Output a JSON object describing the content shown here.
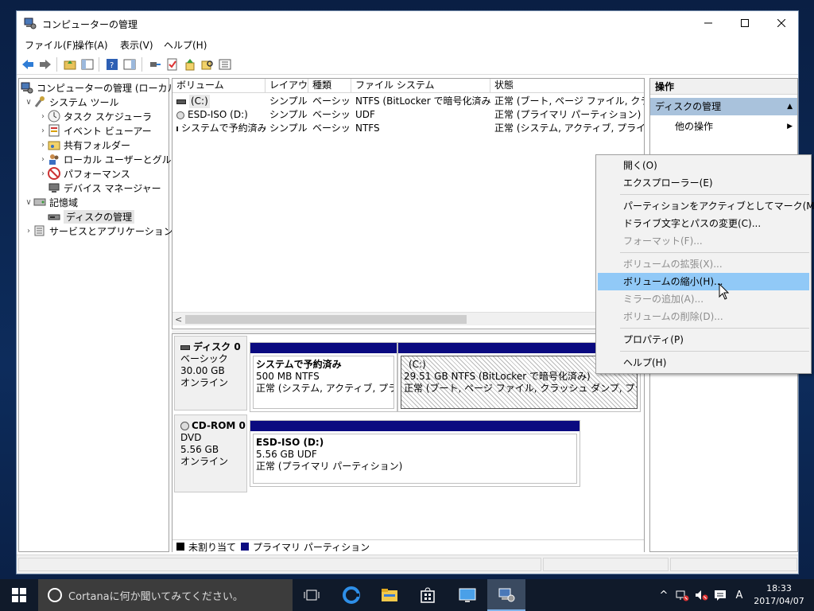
{
  "window": {
    "title": "コンピューターの管理"
  },
  "menu": [
    "ファイル(F)",
    "操作(A)",
    "表示(V)",
    "ヘルプ(H)"
  ],
  "tree": {
    "root": "コンピューターの管理 (ローカル)",
    "system_tools": "システム ツール",
    "task_scheduler": "タスク スケジューラ",
    "event_viewer": "イベント ビューアー",
    "shared_folders": "共有フォルダー",
    "local_users": "ローカル ユーザーとグループ",
    "performance": "パフォーマンス",
    "device_manager": "デバイス マネージャー",
    "storage": "記憶域",
    "disk_management": "ディスクの管理",
    "services": "サービスとアプリケーション"
  },
  "volume_list": {
    "columns": [
      "ボリューム",
      "レイアウト",
      "種類",
      "ファイル システム",
      "状態"
    ],
    "rows": [
      {
        "volume": "(C:)",
        "layout": "シンプル",
        "type": "ベーシック",
        "fs": "NTFS (BitLocker で暗号化済み)",
        "status": "正常 (ブート, ページ ファイル, クラッシュ ダ"
      },
      {
        "volume": "ESD-ISO (D:)",
        "layout": "シンプル",
        "type": "ベーシック",
        "fs": "UDF",
        "status": "正常 (プライマリ パーティション)"
      },
      {
        "volume": "システムで予約済み",
        "layout": "シンプル",
        "type": "ベーシック",
        "fs": "NTFS",
        "status": "正常 (システム, アクティブ, プライマリ パー"
      }
    ]
  },
  "disks": {
    "disk0": {
      "name": "ディスク 0",
      "type": "ベーシック",
      "size": "30.00 GB",
      "state": "オンライン",
      "partitions": [
        {
          "name": "システムで予約済み",
          "size": "500 MB NTFS",
          "status": "正常 (システム, アクティブ, プライマリ パ"
        },
        {
          "name": "(C:)",
          "size": "29.51 GB NTFS (BitLocker で暗号化済み)",
          "status": "正常 (ブート, ページ ファイル, クラッシュ ダンプ, プライマリ パーティ"
        }
      ]
    },
    "cdrom0": {
      "name": "CD-ROM 0",
      "type": "DVD",
      "size": "5.56 GB",
      "state": "オンライン",
      "partitions": [
        {
          "name": "ESD-ISO  (D:)",
          "size": "5.56 GB UDF",
          "status": "正常 (プライマリ パーティション)"
        }
      ]
    }
  },
  "legend": {
    "unallocated": "未割り当て",
    "primary": "プライマリ パーティション",
    "unallocated_color": "#000000",
    "primary_color": "#0a0a80"
  },
  "actions": {
    "header": "操作",
    "section": "ディスクの管理",
    "other": "他の操作"
  },
  "context_menu": {
    "items": [
      {
        "label": "開く(O)",
        "enabled": true
      },
      {
        "label": "エクスプローラー(E)",
        "enabled": true
      },
      {
        "label": "パーティションをアクティブとしてマーク(M)",
        "enabled": true
      },
      {
        "label": "ドライブ文字とパスの変更(C)...",
        "enabled": true
      },
      {
        "label": "フォーマット(F)...",
        "enabled": false
      },
      {
        "label": "ボリュームの拡張(X)...",
        "enabled": false
      },
      {
        "label": "ボリュームの縮小(H)...",
        "enabled": true,
        "highlighted": true
      },
      {
        "label": "ミラーの追加(A)...",
        "enabled": false
      },
      {
        "label": "ボリュームの削除(D)...",
        "enabled": false
      },
      {
        "label": "プロパティ(P)",
        "enabled": true
      },
      {
        "label": "ヘルプ(H)",
        "enabled": true
      }
    ]
  },
  "taskbar": {
    "search_placeholder": "Cortanaに何か聞いてみてください。",
    "ime": "A",
    "time": "18:33",
    "date": "2017/04/07"
  },
  "colors": {
    "partition_bar": "#0a0a80",
    "menu_highlight": "#91c9f7",
    "action_section": "#a9c2dc",
    "taskbar": "#101a2a"
  }
}
